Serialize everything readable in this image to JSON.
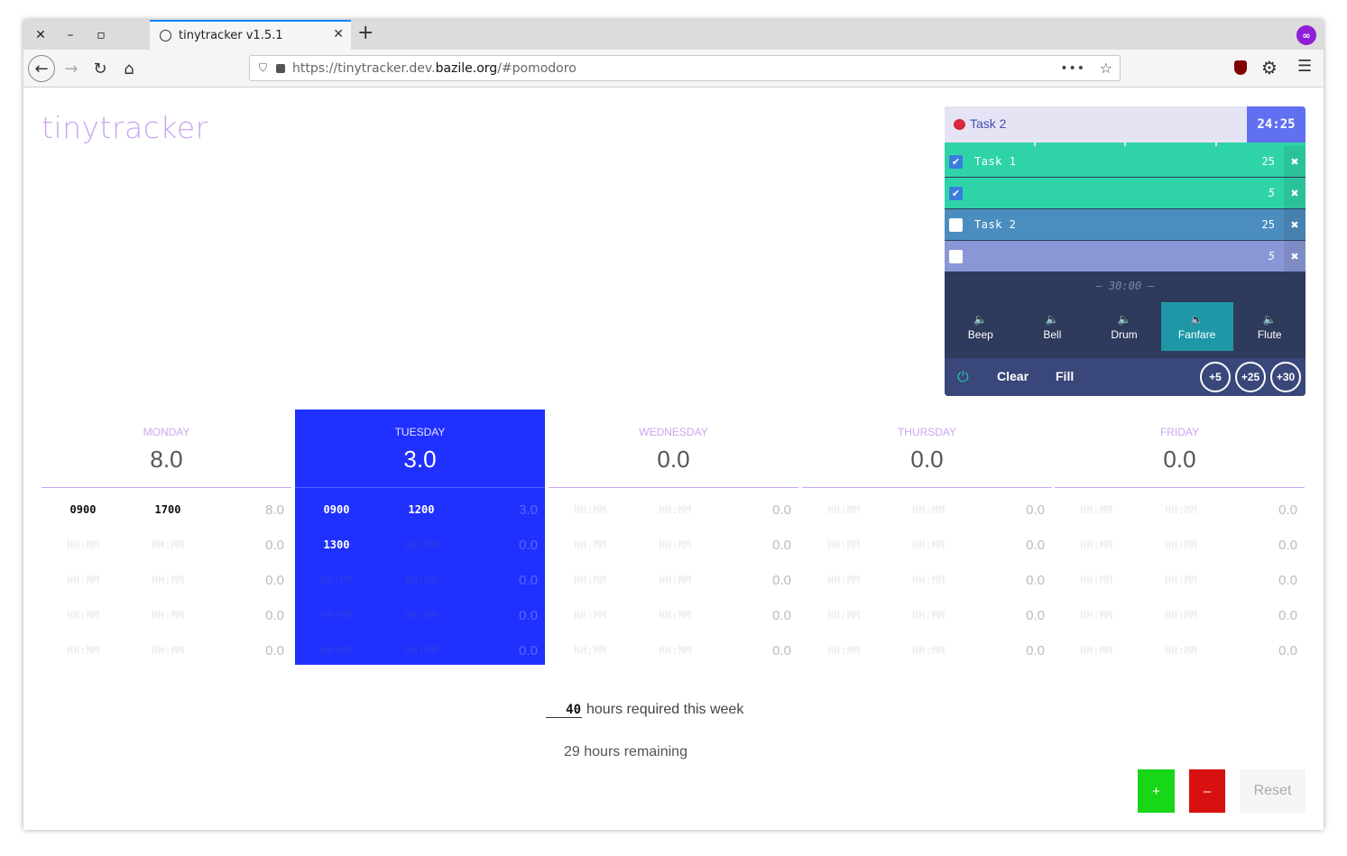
{
  "browser": {
    "tab_title": "tinytracker v1.5.1",
    "url_prefix": "https://tinytracker.dev.",
    "url_domain": "bazile.org",
    "url_suffix": "/#pomodoro",
    "dots": "•••"
  },
  "app": {
    "logo": "tinytracker"
  },
  "pomodoro": {
    "current_task": "Task 2",
    "timer": "24:25",
    "items": [
      {
        "name": "Task 1",
        "minutes": "25",
        "checked": true,
        "color": "#2fd3a8"
      },
      {
        "name": "",
        "minutes": "5",
        "checked": true,
        "color": "#2fd3a8"
      },
      {
        "name": "Task 2",
        "minutes": "25",
        "checked": false,
        "color": "#4c8dbf"
      },
      {
        "name": "",
        "minutes": "5",
        "checked": false,
        "color": "#8a97d6"
      }
    ],
    "total": "—  30:00  —",
    "sounds": [
      "Beep",
      "Bell",
      "Drum",
      "Fanfare",
      "Flute"
    ],
    "active_sound": "Fanfare",
    "clear_label": "Clear",
    "fill_label": "Fill",
    "add_buttons": [
      "+5",
      "+25",
      "+30"
    ],
    "del_glyph": "✖"
  },
  "week": {
    "placeholder": "HH:MM",
    "days": [
      {
        "name": "MONDAY",
        "total": "8.0",
        "today": false,
        "rows": [
          {
            "start": "0900",
            "end": "1700",
            "hours": "8.0"
          },
          {
            "start": "",
            "end": "",
            "hours": "0.0"
          },
          {
            "start": "",
            "end": "",
            "hours": "0.0"
          },
          {
            "start": "",
            "end": "",
            "hours": "0.0"
          },
          {
            "start": "",
            "end": "",
            "hours": "0.0"
          }
        ]
      },
      {
        "name": "TUESDAY",
        "total": "3.0",
        "today": true,
        "rows": [
          {
            "start": "0900",
            "end": "1200",
            "hours": "3.0"
          },
          {
            "start": "1300",
            "end": "",
            "hours": "0.0"
          },
          {
            "start": "",
            "end": "",
            "hours": "0.0"
          },
          {
            "start": "",
            "end": "",
            "hours": "0.0"
          },
          {
            "start": "",
            "end": "",
            "hours": "0.0"
          }
        ]
      },
      {
        "name": "WEDNESDAY",
        "total": "0.0",
        "today": false,
        "rows": [
          {
            "start": "",
            "end": "",
            "hours": "0.0"
          },
          {
            "start": "",
            "end": "",
            "hours": "0.0"
          },
          {
            "start": "",
            "end": "",
            "hours": "0.0"
          },
          {
            "start": "",
            "end": "",
            "hours": "0.0"
          },
          {
            "start": "",
            "end": "",
            "hours": "0.0"
          }
        ]
      },
      {
        "name": "THURSDAY",
        "total": "0.0",
        "today": false,
        "rows": [
          {
            "start": "",
            "end": "",
            "hours": "0.0"
          },
          {
            "start": "",
            "end": "",
            "hours": "0.0"
          },
          {
            "start": "",
            "end": "",
            "hours": "0.0"
          },
          {
            "start": "",
            "end": "",
            "hours": "0.0"
          },
          {
            "start": "",
            "end": "",
            "hours": "0.0"
          }
        ]
      },
      {
        "name": "FRIDAY",
        "total": "0.0",
        "today": false,
        "rows": [
          {
            "start": "",
            "end": "",
            "hours": "0.0"
          },
          {
            "start": "",
            "end": "",
            "hours": "0.0"
          },
          {
            "start": "",
            "end": "",
            "hours": "0.0"
          },
          {
            "start": "",
            "end": "",
            "hours": "0.0"
          },
          {
            "start": "",
            "end": "",
            "hours": "0.0"
          }
        ]
      }
    ]
  },
  "summary": {
    "required_value": "40",
    "required_label": "hours required this week",
    "remaining": "29 hours remaining"
  },
  "actions": {
    "plus": "+",
    "minus": "–",
    "reset": "Reset"
  }
}
